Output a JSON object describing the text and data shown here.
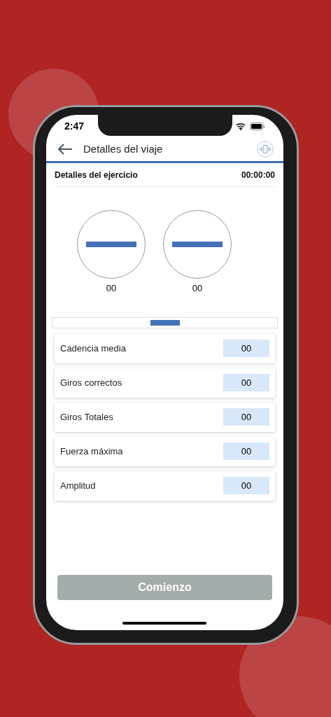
{
  "status_bar": {
    "time": "2:47"
  },
  "header": {
    "title": "Detalles del viaje"
  },
  "section": {
    "title": "Detalles del ejercicio",
    "timer": "00:00:00"
  },
  "gauges": [
    {
      "value": "00"
    },
    {
      "value": "00"
    }
  ],
  "metrics": [
    {
      "label": "Cadencia media",
      "value": "00"
    },
    {
      "label": "Giros correctos",
      "value": "00"
    },
    {
      "label": "Giros Totales",
      "value": "00"
    },
    {
      "label": "Fuerza máxima",
      "value": "00"
    },
    {
      "label": "Amplitud",
      "value": "00"
    }
  ],
  "start_button": {
    "label": "Comienzo",
    "disabled": true
  }
}
